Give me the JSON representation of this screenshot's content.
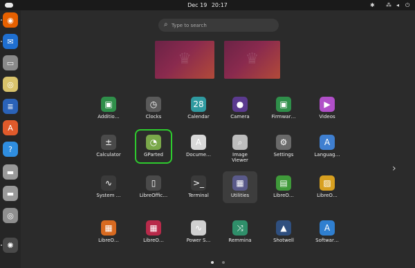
{
  "topbar": {
    "date": "Dec 19",
    "time": "20:17",
    "tray_icons": [
      "accessibility-icon",
      "network-icon",
      "volume-icon",
      "power-icon"
    ]
  },
  "search": {
    "placeholder": "Type to search"
  },
  "dock": {
    "items": [
      {
        "name": "firefox",
        "glyph": "◉",
        "color": "#e66000"
      },
      {
        "name": "thunderbird",
        "glyph": "✉",
        "color": "#1f6fd0"
      },
      {
        "name": "files",
        "glyph": "▭",
        "color": "#8a8a8a"
      },
      {
        "name": "rhythmbox",
        "glyph": "◎",
        "color": "#d9c36b"
      },
      {
        "name": "writer",
        "glyph": "≣",
        "color": "#2a62b8"
      },
      {
        "name": "app-center",
        "glyph": "A",
        "color": "#e05a2b"
      },
      {
        "name": "help",
        "glyph": "?",
        "color": "#2f8ee0"
      },
      {
        "name": "drive-1",
        "glyph": "▬",
        "color": "#9a9a9a"
      },
      {
        "name": "drive-2",
        "glyph": "▬",
        "color": "#9a9a9a"
      },
      {
        "name": "optical-drive",
        "glyph": "◎",
        "color": "#8f8f8f"
      },
      {
        "name": "show-apps",
        "glyph": "✺",
        "color": "#4a4a4a"
      }
    ]
  },
  "apps": [
    {
      "label": "Additio…",
      "glyph": "▣",
      "color": "#2f8f4a"
    },
    {
      "label": "Clocks",
      "glyph": "◷",
      "color": "#5a5a5a"
    },
    {
      "label": "Calendar",
      "glyph": "28",
      "color": "#2f9aa0"
    },
    {
      "label": "Camera",
      "glyph": "●",
      "color": "#5b3a8f"
    },
    {
      "label": "Firmwar…",
      "glyph": "▣",
      "color": "#2f8f4a"
    },
    {
      "label": "Videos",
      "glyph": "▶",
      "color": "#b04fc8"
    },
    {
      "label": "Calculator",
      "glyph": "±",
      "color": "#4a4a4a"
    },
    {
      "label": "GParted",
      "glyph": "◔",
      "color": "#7aa84a"
    },
    {
      "label": "Docume…",
      "glyph": "A",
      "color": "#d8d8d8"
    },
    {
      "label": "Image",
      "label2": "Viewer",
      "glyph": "⌕",
      "color": "#bdbdbd"
    },
    {
      "label": "Settings",
      "glyph": "⚙",
      "color": "#6a6a6a"
    },
    {
      "label": "Languag…",
      "glyph": "A",
      "color": "#3f7fd0"
    },
    {
      "label": "System …",
      "glyph": "∿",
      "color": "#3a3a3a"
    },
    {
      "label": "LibreOffic…",
      "glyph": "▯",
      "color": "#4a4a4a"
    },
    {
      "label": "Terminal",
      "glyph": ">_",
      "color": "#3a3a3a"
    },
    {
      "label": "Utilities",
      "glyph": "▦",
      "color": "#5a5a8a"
    },
    {
      "label": "LibreO…",
      "glyph": "▤",
      "color": "#3f9a3a"
    },
    {
      "label": "LibreO…",
      "glyph": "▨",
      "color": "#d8a020"
    },
    {
      "label": "LibreO…",
      "glyph": "▦",
      "color": "#d86a20"
    },
    {
      "label": "LibreO…",
      "glyph": "▦",
      "color": "#b82a4a"
    },
    {
      "label": "Power S…",
      "glyph": "∿",
      "color": "#d0d0d0"
    },
    {
      "label": "Remmina",
      "glyph": "⤨",
      "color": "#2f8f6a"
    },
    {
      "label": "Shotwell",
      "glyph": "▲",
      "color": "#2f4f7f"
    },
    {
      "label": "Softwar…",
      "glyph": "A",
      "color": "#2f7fd0"
    }
  ],
  "pagination": {
    "current": 1,
    "total": 2
  }
}
